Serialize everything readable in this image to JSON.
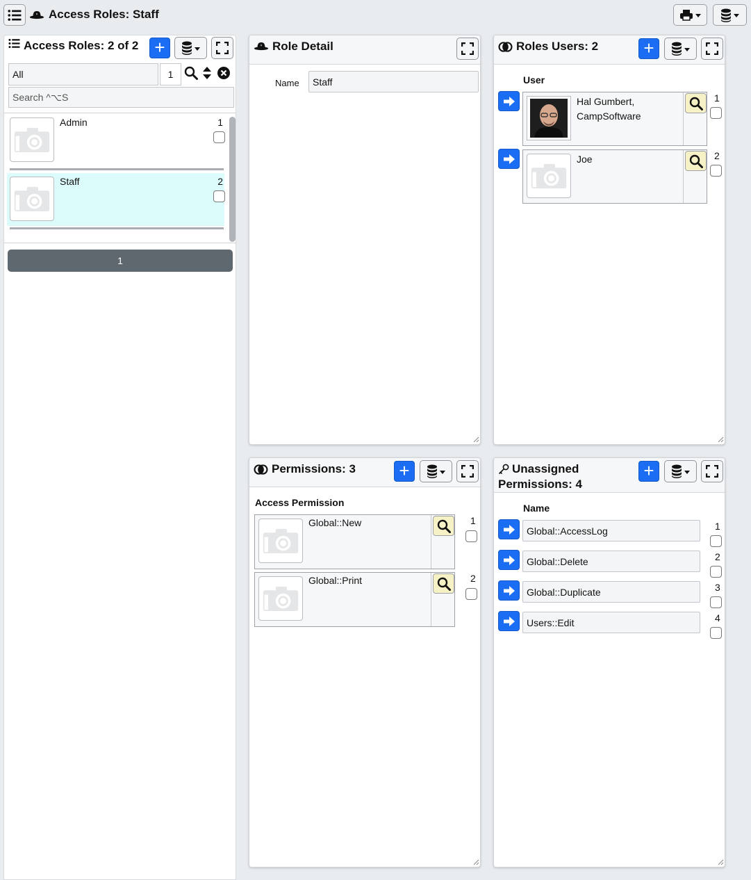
{
  "app": {
    "title": "Access Roles: Staff"
  },
  "roles_list": {
    "title": "Access Roles: 2 of 2",
    "filter_value": "All",
    "page_value": "1",
    "search_placeholder": "Search ^⌥S",
    "items": [
      {
        "label": "Admin",
        "index": "1"
      },
      {
        "label": "Staff",
        "index": "2"
      }
    ],
    "pager_label": "1"
  },
  "role_detail": {
    "title": "Role Detail",
    "name_label": "Name",
    "name_value": "Staff"
  },
  "roles_users": {
    "title": "Roles Users: 2",
    "column": "User",
    "rows": [
      {
        "name": "Hal Gumbert, CampSoftware",
        "index": "1"
      },
      {
        "name": "Joe",
        "index": "2"
      }
    ]
  },
  "permissions": {
    "title": "Permissions: 3",
    "column": "Access Permission",
    "rows": [
      {
        "name": "Global::New",
        "index": "1"
      },
      {
        "name": "Global::Print",
        "index": "2"
      }
    ]
  },
  "unassigned": {
    "title_line1": "Unassigned",
    "title_line2": "Permissions: 4",
    "column": "Name",
    "rows": [
      {
        "name": "Global::AccessLog",
        "index": "1"
      },
      {
        "name": "Global::Delete",
        "index": "2"
      },
      {
        "name": "Global::Duplicate",
        "index": "3"
      },
      {
        "name": "Users::Edit",
        "index": "4"
      }
    ]
  },
  "colors": {
    "accent": "#1b6ef3",
    "selected_row": "#dcfbfb",
    "pager": "#5f676f",
    "magnifier_bg": "#f6f2c6"
  },
  "icons": [
    "list-icon",
    "hat-icon",
    "print-icon",
    "database-icon",
    "plus-icon",
    "fullscreen-icon",
    "search-icon",
    "sort-icon",
    "clear-icon",
    "camera-icon",
    "arrow-right-icon",
    "magnifier-icon",
    "linked-circles-icon",
    "key-icon"
  ]
}
